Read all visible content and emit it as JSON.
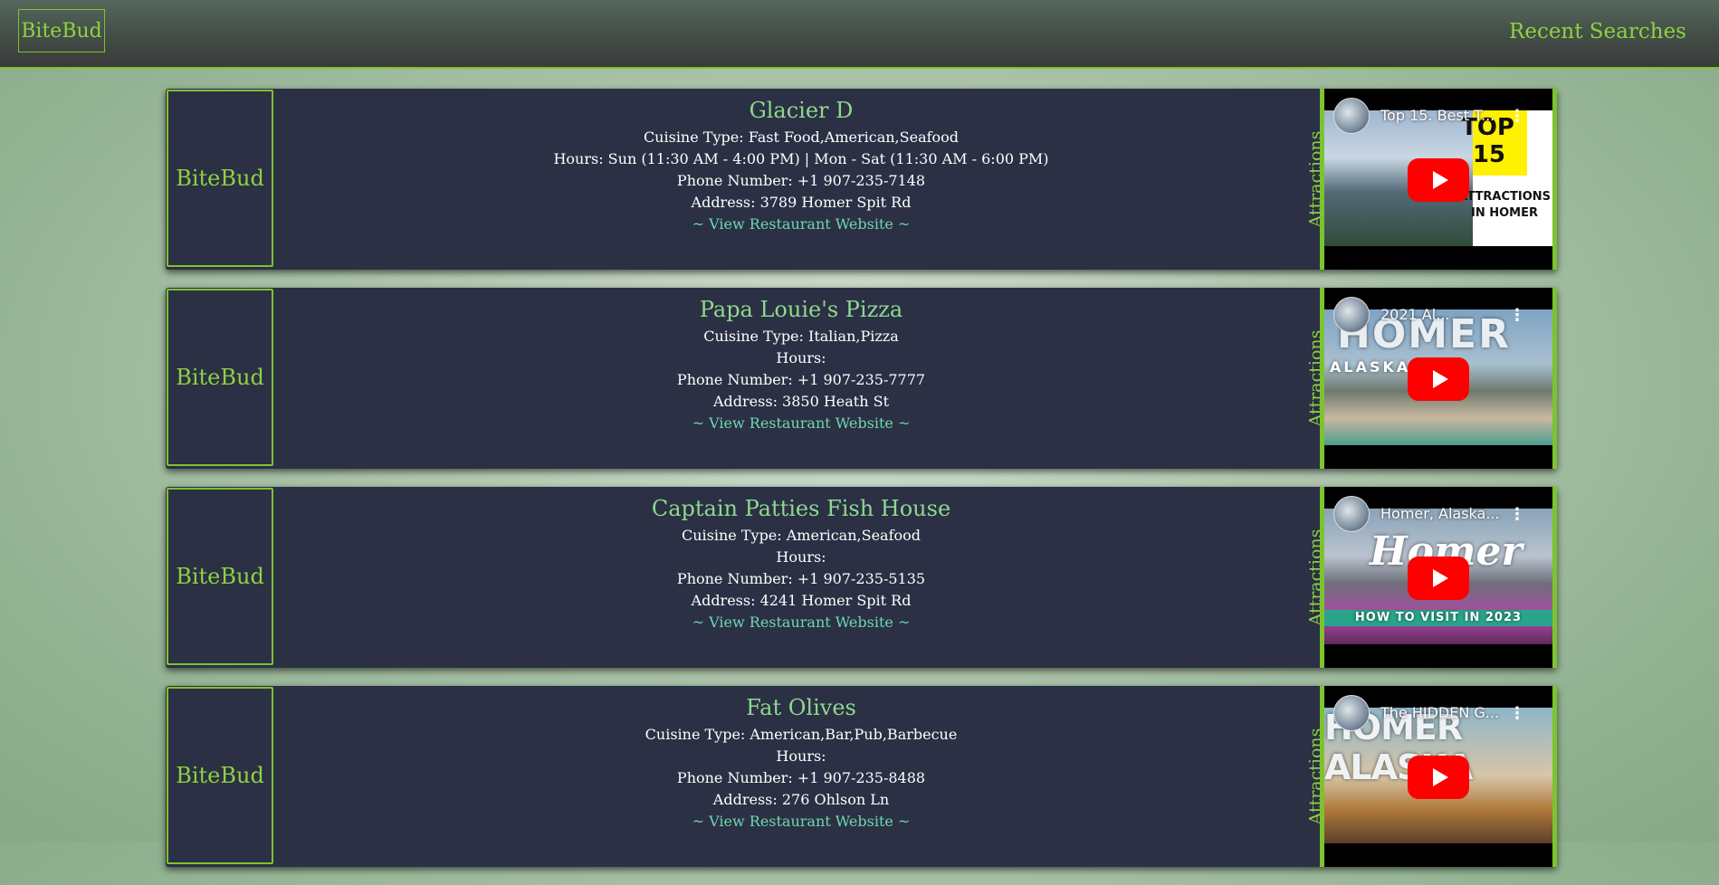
{
  "nav": {
    "brand": "BiteBud",
    "recent_searches": "Recent Searches"
  },
  "restaurants": [
    {
      "logo": "BiteBud",
      "name": "Glacier D",
      "cuisine": "Cuisine Type: Fast Food,American,Seafood",
      "hours": "Hours: Sun (11:30 AM - 4:00 PM) | Mon - Sat (11:30 AM - 6:00 PM)",
      "phone": "Phone Number: +1 907-235-7148",
      "address": "Address: 3789 Homer Spit Rd",
      "website": "~ View Restaurant Website ~",
      "attractions": "Attractions",
      "video": {
        "title": "Top 15. Best T...",
        "thumb_text_1": "TOP",
        "thumb_text_2": "15",
        "thumb_text_3": "ATTRACTIONS",
        "thumb_text_4": "IN HOMER"
      }
    },
    {
      "logo": "BiteBud",
      "name": "Papa Louie's Pizza",
      "cuisine": "Cuisine Type: Italian,Pizza",
      "hours": "Hours:",
      "phone": "Phone Number: +1 907-235-7777",
      "address": "Address: 3850 Heath St",
      "website": "~ View Restaurant Website ~",
      "attractions": "Attractions",
      "video": {
        "title": "2021 Al...",
        "thumb_text_1": "HOMER",
        "thumb_text_2": "ALASKA"
      }
    },
    {
      "logo": "BiteBud",
      "name": "Captain Patties Fish House",
      "cuisine": "Cuisine Type: American,Seafood",
      "hours": "Hours:",
      "phone": "Phone Number: +1 907-235-5135",
      "address": "Address: 4241 Homer Spit Rd",
      "website": "~ View Restaurant Website ~",
      "attractions": "Attractions",
      "video": {
        "title": "Homer, Alaska...",
        "thumb_text_1": "Homer",
        "thumb_text_2": "HOW TO VISIT IN 2023"
      }
    },
    {
      "logo": "BiteBud",
      "name": "Fat Olives",
      "cuisine": "Cuisine Type: American,Bar,Pub,Barbecue",
      "hours": "Hours:",
      "phone": "Phone Number: +1 907-235-8488",
      "address": "Address: 276 Ohlson Ln",
      "website": "~ View Restaurant Website ~",
      "attractions": "Attractions",
      "video": {
        "title": "The HIDDEN G...",
        "thumb_text_1": "HOMER ALASKA"
      }
    }
  ]
}
